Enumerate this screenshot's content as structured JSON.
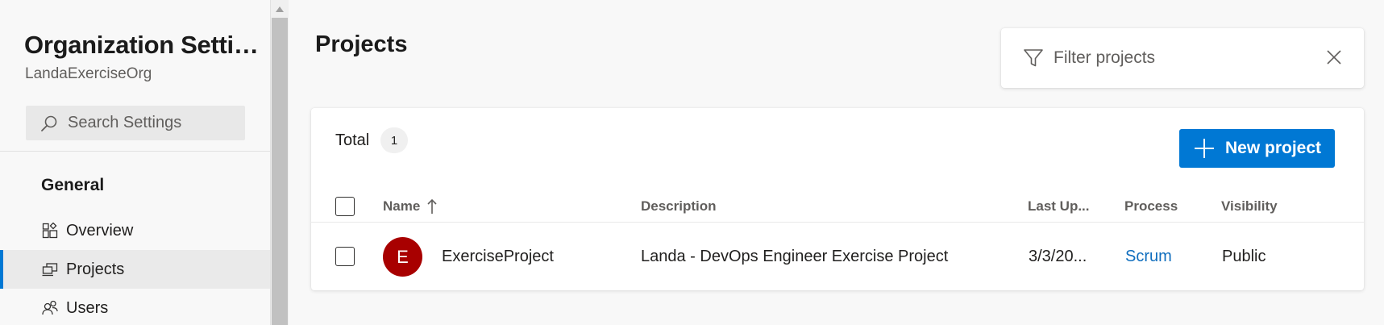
{
  "sidebar": {
    "org_title": "Organization Settin...",
    "org_subtitle": "LandaExerciseOrg",
    "search_placeholder": "Search Settings",
    "section_header": "General",
    "items": [
      {
        "label": "Overview",
        "icon": "overview-icon",
        "selected": false
      },
      {
        "label": "Projects",
        "icon": "projects-icon",
        "selected": true
      },
      {
        "label": "Users",
        "icon": "users-icon",
        "selected": false
      }
    ]
  },
  "main": {
    "title": "Projects",
    "filter_placeholder": "Filter projects",
    "total_label": "Total",
    "total_count": "1",
    "new_project_label": "New project",
    "columns": {
      "name": "Name",
      "description": "Description",
      "last_updated": "Last Up...",
      "process": "Process",
      "visibility": "Visibility"
    },
    "rows": [
      {
        "avatar_letter": "E",
        "name": "ExerciseProject",
        "description": "Landa - DevOps Engineer Exercise Project",
        "last_updated": "3/3/20...",
        "process": "Scrum",
        "visibility": "Public"
      }
    ]
  },
  "colors": {
    "accent": "#0078d4",
    "avatar": "#a80000",
    "link": "#106ebe"
  }
}
